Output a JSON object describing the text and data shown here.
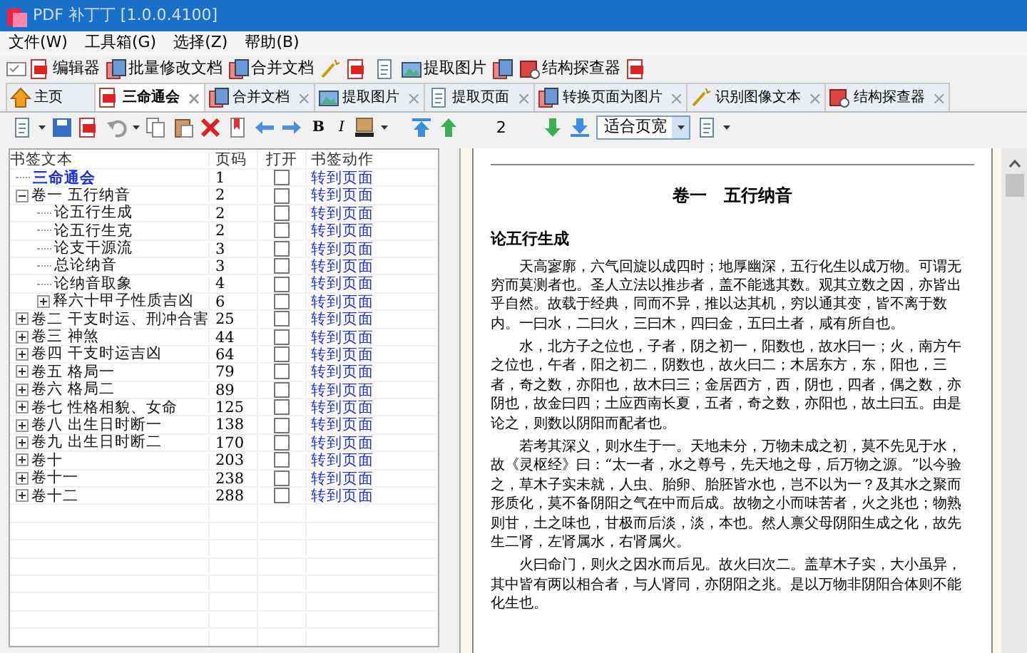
{
  "window": {
    "title": "PDF 补丁丁 [1.0.0.4100]"
  },
  "menu": [
    "文件(W)",
    "工具箱(G)",
    "选择(Z)",
    "帮助(B)"
  ],
  "toolbar": [
    "编辑器",
    "批量修改文档",
    "合并文档",
    "提取图片",
    "结构探查器"
  ],
  "tabs": [
    {
      "label": "主页",
      "selected": false,
      "closable": false
    },
    {
      "label": "三命通会",
      "selected": true,
      "closable": true
    },
    {
      "label": "合并文档",
      "selected": false,
      "closable": true
    },
    {
      "label": "提取图片",
      "selected": false,
      "closable": true
    },
    {
      "label": "提取页面",
      "selected": false,
      "closable": true
    },
    {
      "label": "转换页面为图片",
      "selected": false,
      "closable": true
    },
    {
      "label": "识别图像文本",
      "selected": false,
      "closable": true
    },
    {
      "label": "结构探查器",
      "selected": false,
      "closable": true
    }
  ],
  "close_glyph": "×",
  "editor_toolbar": {
    "format_buttons": [
      "B",
      "I"
    ],
    "page_number": "2",
    "zoom": "适合页宽"
  },
  "bookmarks": {
    "columns": [
      "书签文本",
      "页码",
      "打开",
      "书签动作"
    ],
    "rows": [
      {
        "kind": "title",
        "text": "三命通会",
        "page": "1",
        "open": false,
        "action": "转到页面"
      },
      {
        "kind": "section",
        "text": "卷一  五行纳音",
        "page": "2",
        "open": false,
        "action": "转到页面",
        "expanded": true,
        "children": [
          {
            "kind": "section",
            "text": "论五行生成",
            "page": "2",
            "open": false,
            "action": "转到页面"
          },
          {
            "kind": "section",
            "text": "论五行生克",
            "page": "2",
            "open": false,
            "action": "转到页面"
          },
          {
            "kind": "section",
            "text": "论支干源流",
            "page": "3",
            "open": false,
            "action": "转到页面"
          },
          {
            "kind": "section",
            "text": "总论纳音",
            "page": "3",
            "open": false,
            "action": "转到页面"
          },
          {
            "kind": "section",
            "text": "论纳音取象",
            "page": "4",
            "open": false,
            "action": "转到页面"
          },
          {
            "kind": "section",
            "text": "释六十甲子性质吉凶",
            "page": "6",
            "open": false,
            "action": "转到页面",
            "expanded": false
          }
        ]
      },
      {
        "kind": "section",
        "text": "卷二  干支时运、刑冲合害",
        "page": "25",
        "open": false,
        "action": "转到页面",
        "expanded": false
      },
      {
        "kind": "section",
        "text": "卷三  神煞",
        "page": "44",
        "open": false,
        "action": "转到页面",
        "expanded": false
      },
      {
        "kind": "section",
        "text": "卷四  干支时运吉凶",
        "page": "64",
        "open": false,
        "action": "转到页面",
        "expanded": false
      },
      {
        "kind": "section",
        "text": "卷五  格局一",
        "page": "79",
        "open": false,
        "action": "转到页面",
        "expanded": false
      },
      {
        "kind": "section",
        "text": "卷六  格局二",
        "page": "89",
        "open": false,
        "action": "转到页面",
        "expanded": false
      },
      {
        "kind": "section",
        "text": "卷七  性格相貌、女命",
        "page": "125",
        "open": false,
        "action": "转到页面",
        "expanded": false
      },
      {
        "kind": "section",
        "text": "卷八  出生日时断一",
        "page": "138",
        "open": false,
        "action": "转到页面",
        "expanded": false
      },
      {
        "kind": "section",
        "text": "卷九  出生日时断二",
        "page": "170",
        "open": false,
        "action": "转到页面",
        "expanded": false
      },
      {
        "kind": "section",
        "text": "卷十",
        "page": "203",
        "open": false,
        "action": "转到页面",
        "expanded": false
      },
      {
        "kind": "section",
        "text": "卷十一",
        "page": "238",
        "open": false,
        "action": "转到页面",
        "expanded": false
      },
      {
        "kind": "section",
        "text": "卷十二",
        "page": "288",
        "open": false,
        "action": "转到页面",
        "expanded": false
      }
    ]
  },
  "document": {
    "title": "卷一　五行纳音",
    "heading": "论五行生成",
    "paragraphs": [
      "天高寥廓，六气回旋以成四时；地厚幽深，五行化生以成万物。可谓无穷而莫测者也。圣人立法以推步者，盖不能逃其数。观其立数之因，亦皆出乎自然。故载于经典，同而不异，推以达其机，穷以通其变，皆不离于数内。一曰水，二曰火，三曰木，四曰金，五曰土者，咸有所自也。",
      "水，北方子之位也，子者，阴之初一，阳数也，故水曰一；火，南方午之位也，午者，阳之初二，阴数也，故火曰二；木居东方，东，阳也，三者，奇之数，亦阳也，故木曰三；金居西方，西，阴也，四者，偶之数，亦阴也，故金曰四；土应西南长夏，五者，奇之数，亦阳也，故土曰五。由是论之，则数以阴阳而配者也。",
      "若考其深义，则水生于一。天地未分，万物未成之初，莫不先见于水，故《灵枢经》曰：“太一者，水之尊号，先天地之母，后万物之源。”以今验之，草木子实未就，人虫、胎卵、胎胚皆水也，岂不以为一？及其水之聚而形质化，莫不备阴阳之气在中而后成。故物之小而味苦者，火之兆也；物熟则甘，土之味也，甘极而后淡，淡，本也。然人禀父母阴阳生成之化，故先生二肾，左肾属水，右肾属火。",
      "火曰命门，则火之因水而后见。故火曰次二。盖草木子实，大小虽异，其中皆有两以相合者，与人肾同，亦阴阳之兆。是以万物非阴阳合体则不能化生也。"
    ]
  }
}
